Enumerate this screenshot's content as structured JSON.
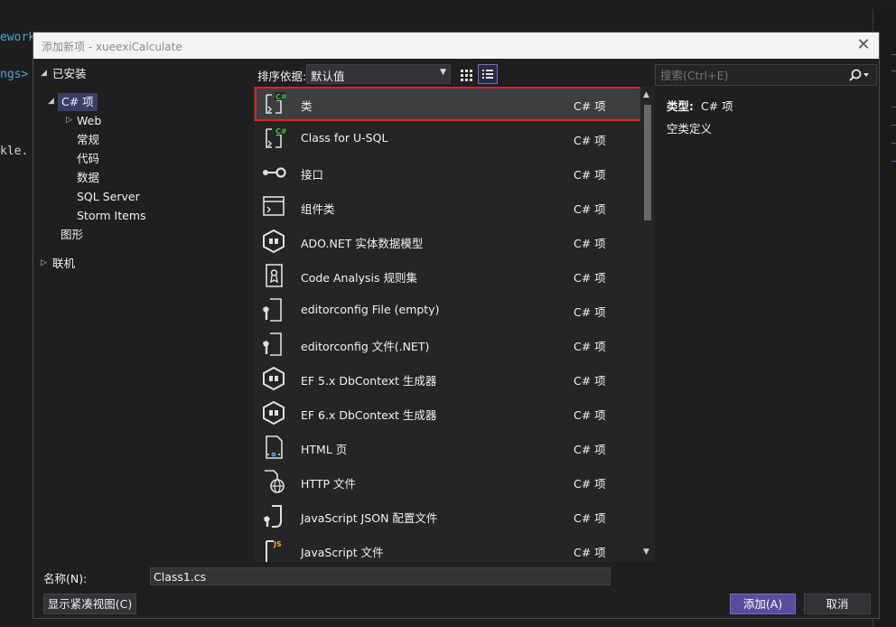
{
  "background": {
    "code_fragments": [
      "ework",
      "ngs>",
      "kle."
    ]
  },
  "dialog": {
    "title": "添加新项 - xueexiCalculate",
    "close_glyph": "✕"
  },
  "tree": {
    "installed": "已安装",
    "csharp": "C# 项",
    "web": "Web",
    "common": "常规",
    "code": "代码",
    "data": "数据",
    "sql_server": "SQL Server",
    "storm_items": "Storm Items",
    "graphics": "图形",
    "online": "联机"
  },
  "toolbar": {
    "sort_label": "排序依据:",
    "sort_value": "默认值"
  },
  "search": {
    "placeholder": "搜索(Ctrl+E)"
  },
  "items": [
    {
      "name": "类",
      "type": "C# 项",
      "icon": "class-icon"
    },
    {
      "name": "Class for U-SQL",
      "type": "C# 项",
      "icon": "class-icon"
    },
    {
      "name": "接口",
      "type": "C# 项",
      "icon": "interface-icon"
    },
    {
      "name": "组件类",
      "type": "C# 项",
      "icon": "component-icon"
    },
    {
      "name": "ADO.NET 实体数据模型",
      "type": "C# 项",
      "icon": "entity-model-icon"
    },
    {
      "name": "Code Analysis 规则集",
      "type": "C# 项",
      "icon": "ruleset-icon"
    },
    {
      "name": "editorconfig File (empty)",
      "type": "C# 项",
      "icon": "config-file-icon"
    },
    {
      "name": "editorconfig 文件(.NET)",
      "type": "C# 项",
      "icon": "config-file-icon"
    },
    {
      "name": "EF 5.x DbContext 生成器",
      "type": "C# 项",
      "icon": "entity-model-icon"
    },
    {
      "name": "EF 6.x DbContext 生成器",
      "type": "C# 项",
      "icon": "entity-model-icon"
    },
    {
      "name": "HTML 页",
      "type": "C# 项",
      "icon": "html-page-icon"
    },
    {
      "name": "HTTP 文件",
      "type": "C# 项",
      "icon": "http-file-icon"
    },
    {
      "name": "JavaScript JSON 配置文件",
      "type": "C# 项",
      "icon": "json-config-icon"
    },
    {
      "name": "JavaScript 文件",
      "type": "C# 项",
      "icon": "javascript-file-icon"
    }
  ],
  "detail": {
    "type_label": "类型:",
    "type_value": "C# 项",
    "description": "空类定义"
  },
  "bottom": {
    "name_label": "名称(N):",
    "name_value": "Class1.cs",
    "compact_button": "显示紧凑视图(C)",
    "add_button": "添加(A)",
    "cancel_button": "取消"
  },
  "colors": {
    "accent": "#5b4b9e",
    "selection_outline": "#e02020",
    "csharp_badge": "#3fbf3f"
  }
}
